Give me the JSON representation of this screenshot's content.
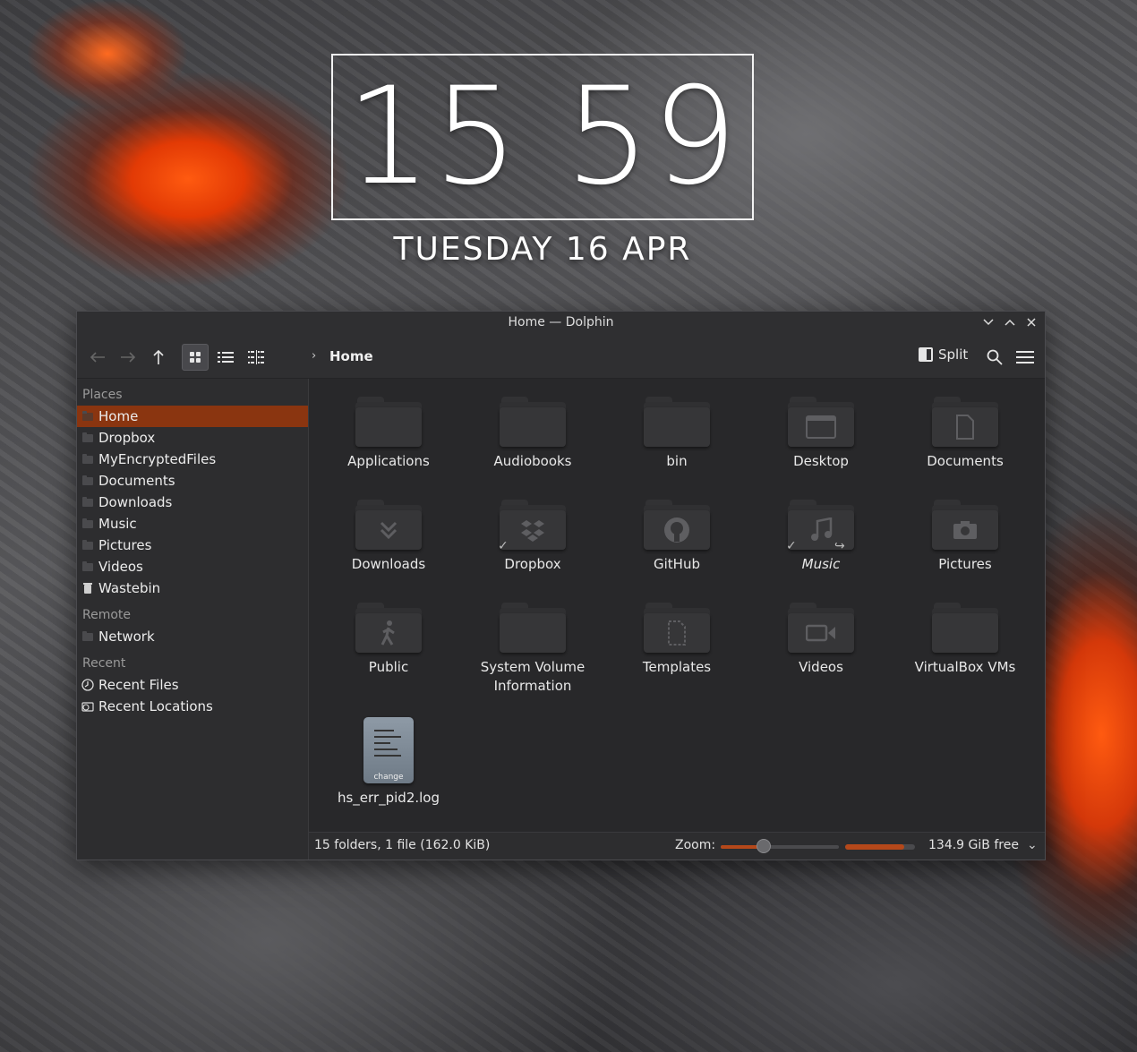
{
  "clock": {
    "hours": "15",
    "minutes": "59",
    "date": "TUESDAY 16 APR"
  },
  "window": {
    "title": "Home — Dolphin"
  },
  "toolbar": {
    "breadcrumb": "Home",
    "split_label": "Split",
    "view_mode": "icons"
  },
  "sidebar": {
    "places_title": "Places",
    "places": [
      "Home",
      "Dropbox",
      "MyEncryptedFiles",
      "Documents",
      "Downloads",
      "Music",
      "Pictures",
      "Videos",
      "Wastebin"
    ],
    "remote_title": "Remote",
    "remote": [
      "Network"
    ],
    "recent_title": "Recent",
    "recent": [
      "Recent Files",
      "Recent Locations"
    ]
  },
  "items": [
    {
      "name": "Applications",
      "icon": "folder-icon"
    },
    {
      "name": "Audiobooks",
      "icon": "folder-icon"
    },
    {
      "name": "bin",
      "icon": "folder-icon"
    },
    {
      "name": "Desktop",
      "icon": "folder-desktop-icon"
    },
    {
      "name": "Documents",
      "icon": "folder-documents-icon"
    },
    {
      "name": "Downloads",
      "icon": "folder-downloads-icon"
    },
    {
      "name": "Dropbox",
      "icon": "folder-dropbox-icon"
    },
    {
      "name": "GitHub",
      "icon": "folder-github-icon"
    },
    {
      "name": "Music",
      "icon": "folder-music-icon"
    },
    {
      "name": "Pictures",
      "icon": "folder-pictures-icon"
    },
    {
      "name": "Public",
      "icon": "folder-public-icon"
    },
    {
      "name": "System Volume Information",
      "icon": "folder-icon"
    },
    {
      "name": "Templates",
      "icon": "folder-templates-icon"
    },
    {
      "name": "Videos",
      "icon": "folder-videos-icon"
    },
    {
      "name": "VirtualBox VMs",
      "icon": "folder-icon"
    },
    {
      "name": "hs_err_pid2.log",
      "icon": "log-file-icon",
      "tag": "change"
    }
  ],
  "status": {
    "summary": "15 folders, 1 file (162.0 KiB)",
    "zoom_label": "Zoom:",
    "free_space": "134.9 GiB free",
    "zoom_fraction": 0.36,
    "used_fraction": 0.85
  },
  "colors": {
    "accent": "#8a3510",
    "accent_line": "#b5481a"
  }
}
